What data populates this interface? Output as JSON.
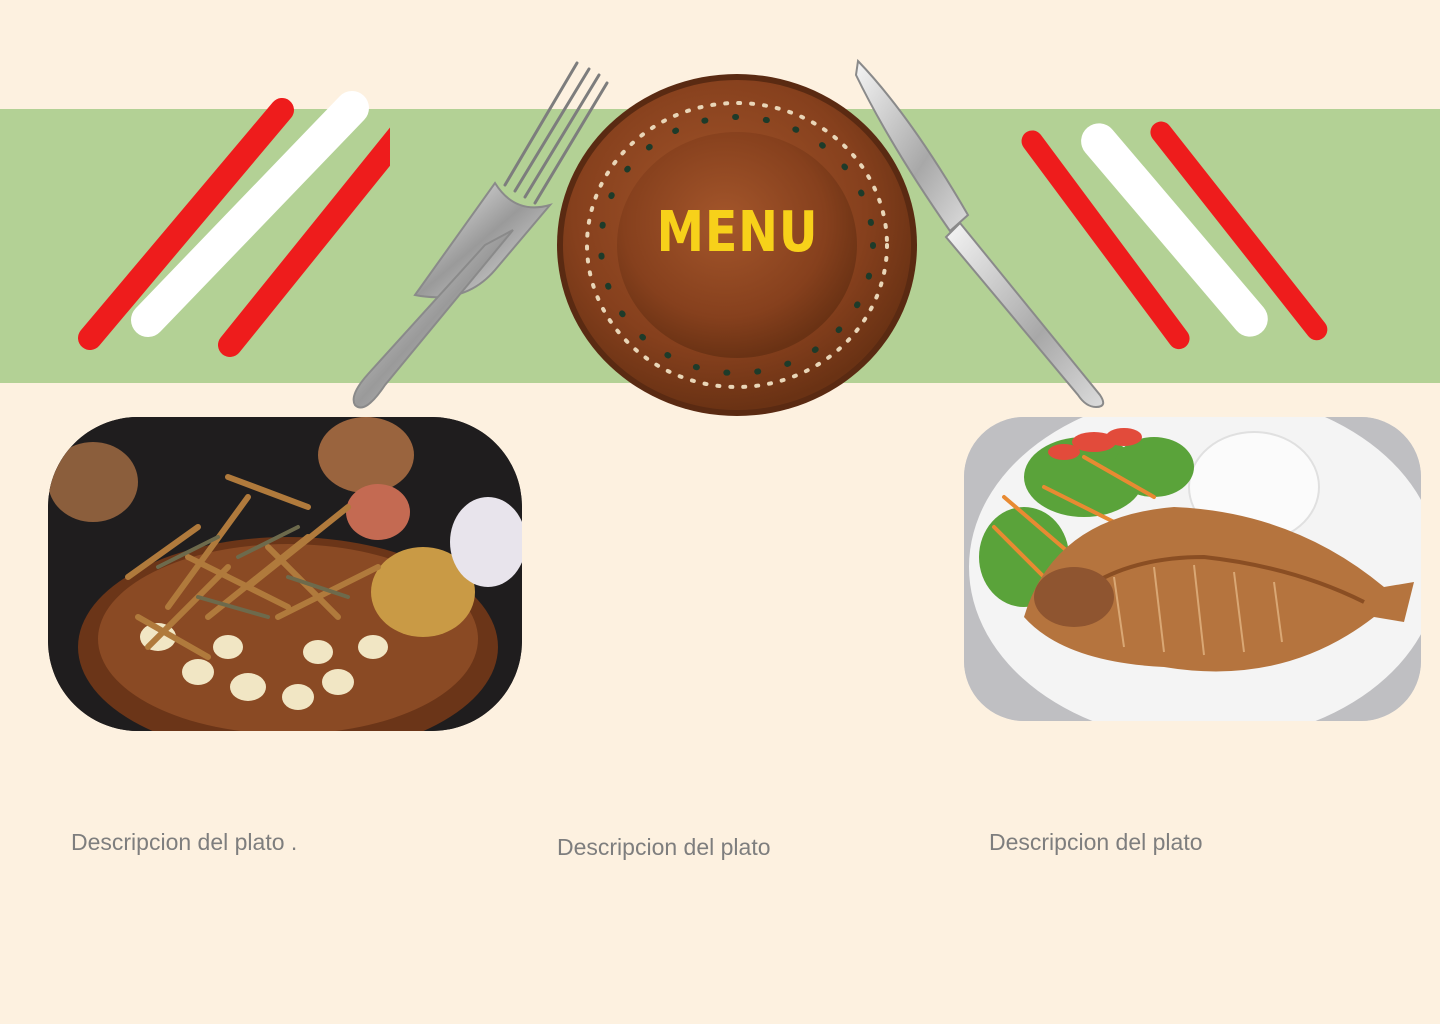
{
  "menu": {
    "title": "MENU"
  },
  "dishes": [
    {
      "description": "Descripcion del plato .",
      "image": "fried-anchovies-with-potatoes-photo"
    },
    {
      "description": "Descripcion del plato",
      "image": ""
    },
    {
      "description": "Descripcion del plato",
      "image": "fried-fish-with-rice-and-salad-photo"
    }
  ],
  "colors": {
    "background": "#fdf1e0",
    "band": "#b3d195",
    "flag_red": "#ee1c1c",
    "flag_white": "#ffffff",
    "plate_brown": "#8a4421",
    "title_yellow": "#f7d11a",
    "description_gray": "#7e7e7e"
  },
  "icons": [
    "peru-flag-brush-left",
    "fork-icon",
    "clay-plate",
    "knife-icon",
    "peru-flag-brush-right"
  ]
}
